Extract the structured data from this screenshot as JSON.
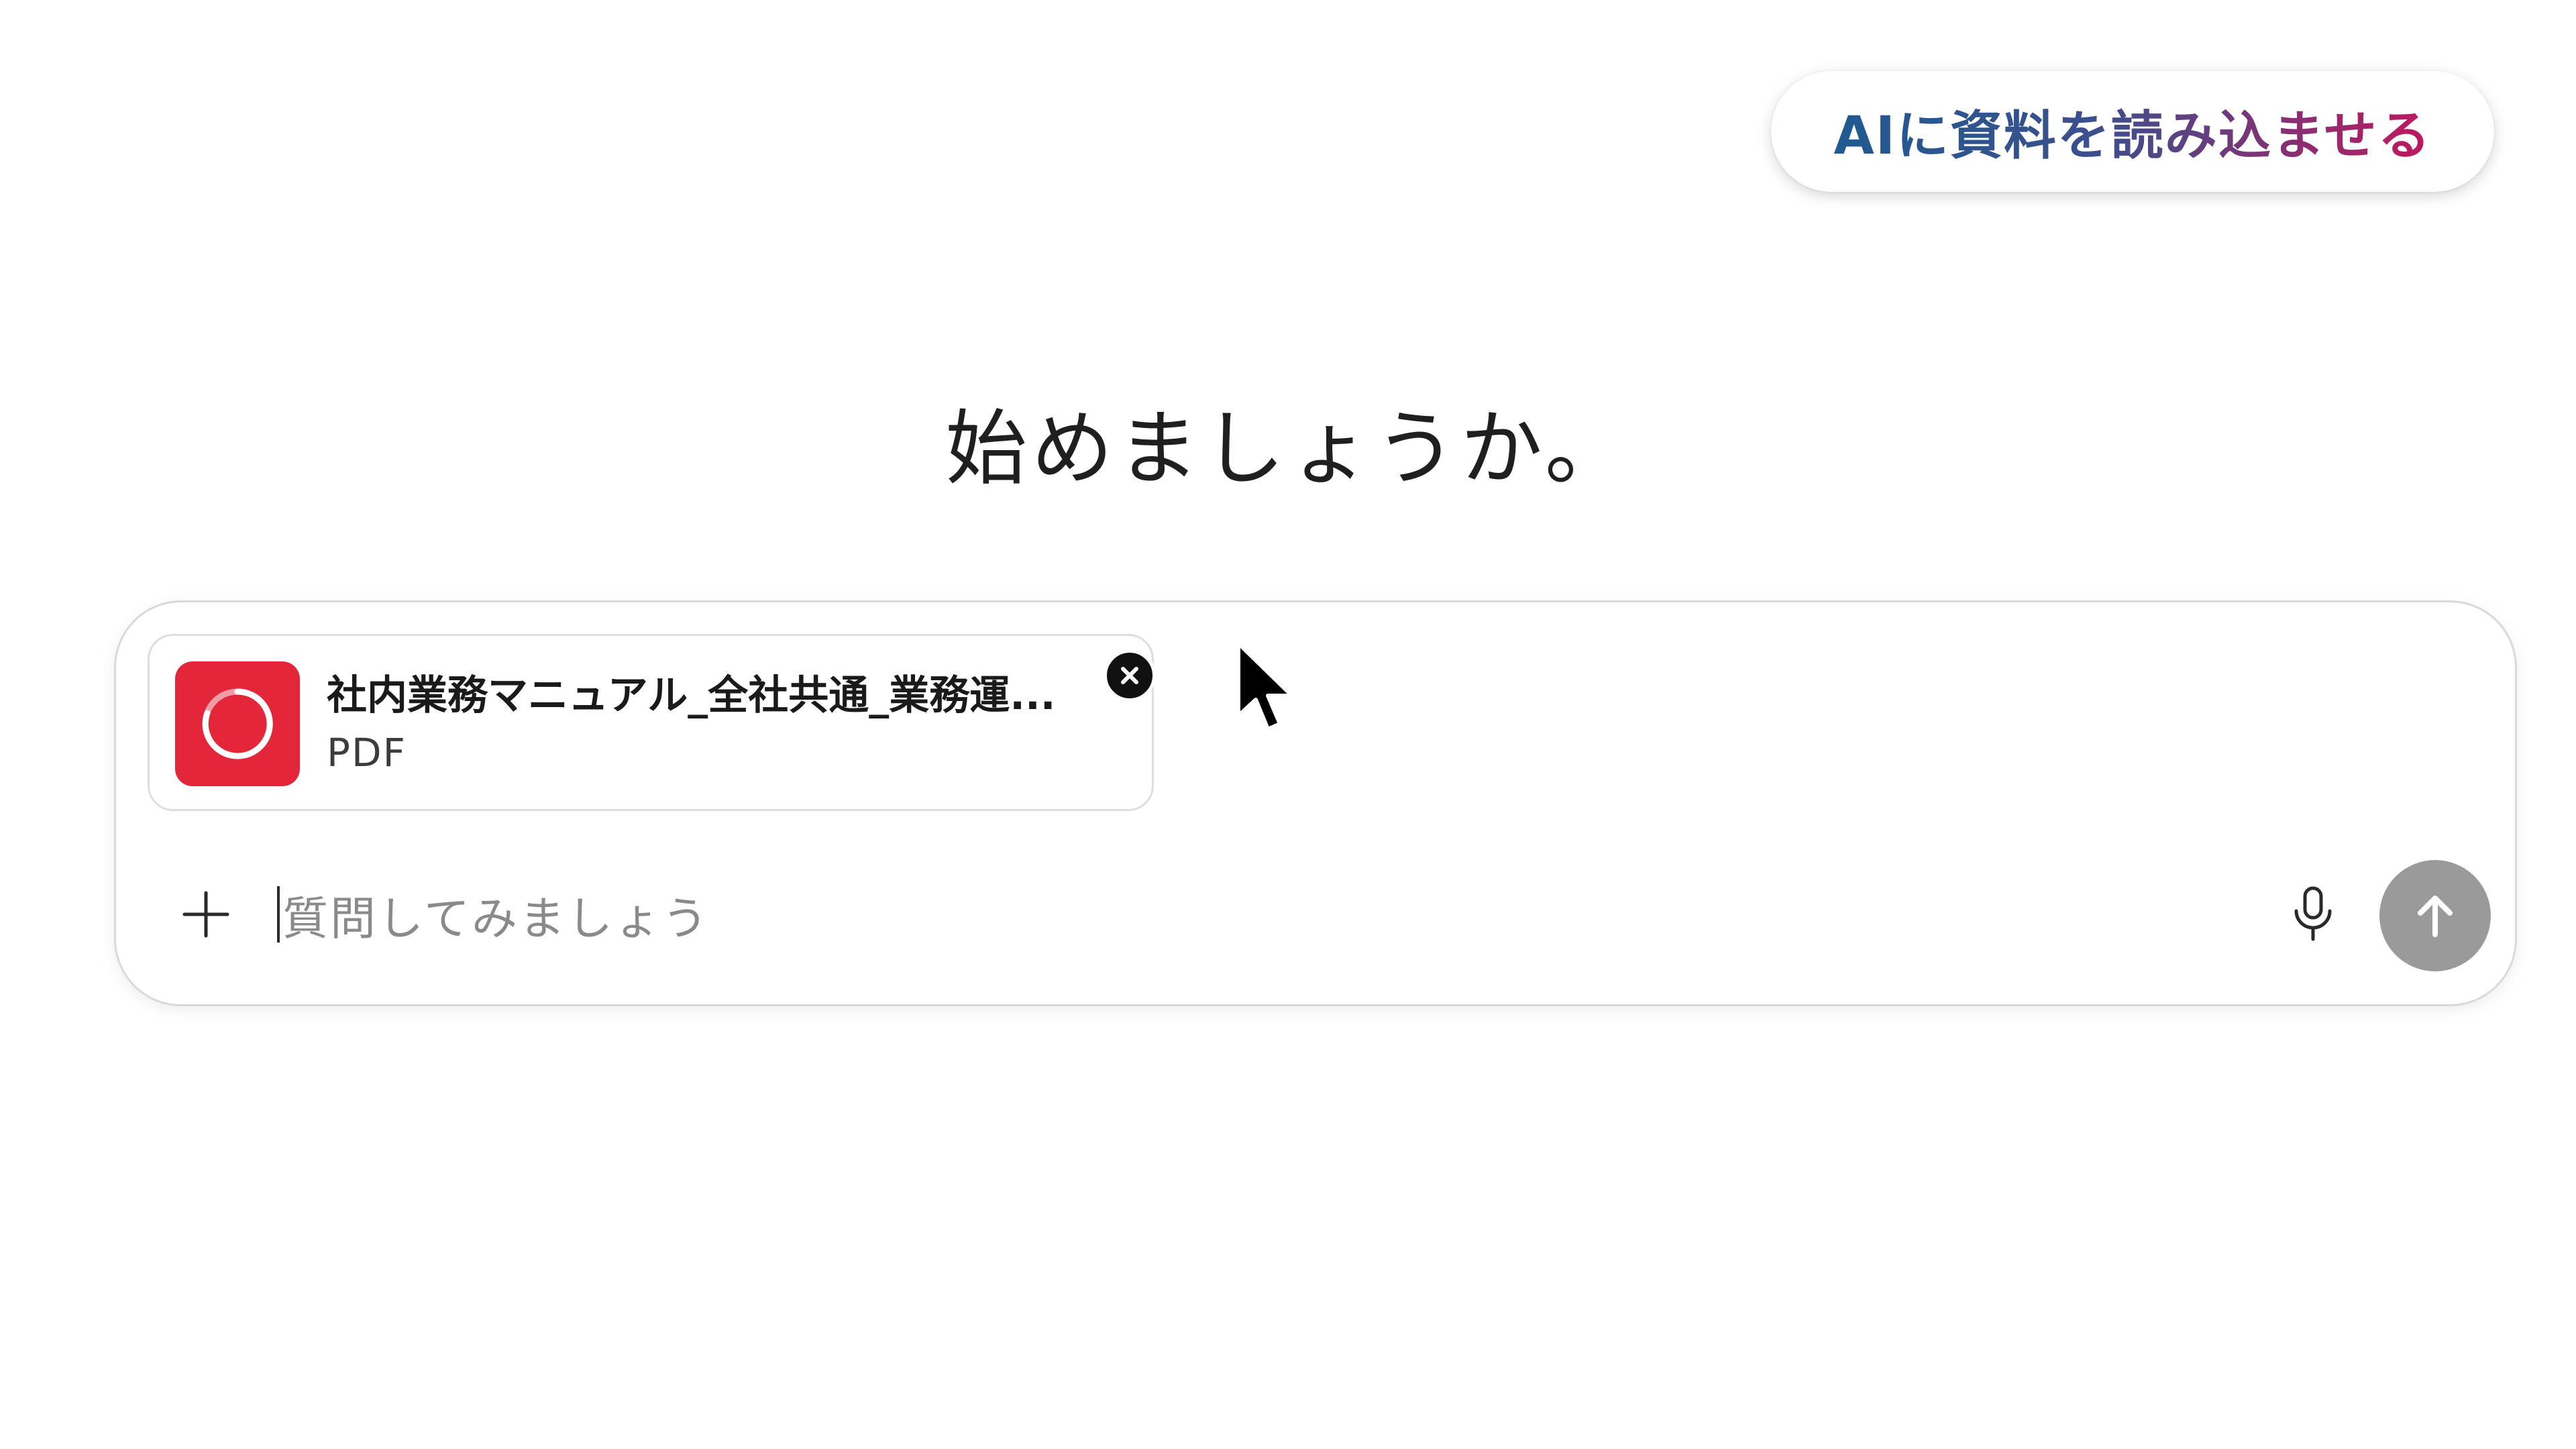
{
  "caption_pill": {
    "text": "AIに資料を読み込ませる"
  },
  "heading": {
    "text": "始めましょうか。"
  },
  "composer": {
    "attachment": {
      "file_name": "社内業務マニュアル_全社共通_業務運...",
      "file_type": "PDF",
      "thumb_icon": "loading-ring-icon",
      "thumb_color": "#e3263a",
      "remove_icon": "close-circle-icon"
    },
    "add_icon": "plus-icon",
    "input": {
      "placeholder": "質問してみましょう",
      "value": ""
    },
    "mic_icon": "microphone-icon",
    "send_icon": "arrow-up-icon",
    "send_color": "#9a9a9a"
  },
  "colors": {
    "gradient_start": "#1f5a91",
    "gradient_end": "#c0185e"
  }
}
